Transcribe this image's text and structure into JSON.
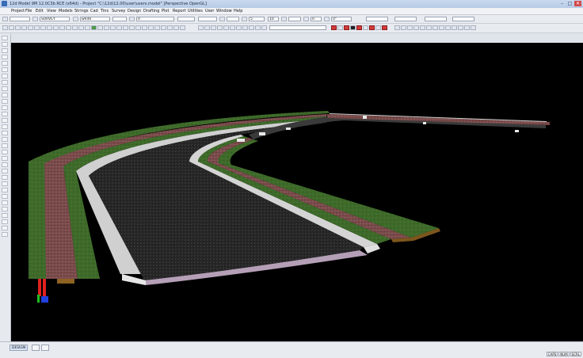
{
  "window": {
    "title": "12d Model 9M 12.0C3b RCE (x64d) - Project \"C:\\12d\\12.00\\user\\users.model\" [Perspective OpenGL]",
    "minimize": "–",
    "maximize": "□",
    "close": "✕"
  },
  "menubar": [
    "Project",
    "File",
    "Edit",
    "View",
    "Models",
    "Strings",
    "Cad",
    "Tins",
    "Survey",
    "Design",
    "Drafting",
    "Plot",
    "Report",
    "Utilities",
    "User",
    "Window",
    "Help"
  ],
  "toolbar1": {
    "model": "SURVEY",
    "colour": "white",
    "linetype_value": "0",
    "weight_value": "5",
    "text_size": "10",
    "angle_value": "0",
    "rotation_value": "0°"
  },
  "statusbar": {
    "tabs": [
      "DESIGN",
      "",
      ""
    ],
    "indicators": [
      "CAPS",
      "NUM",
      "SCRL"
    ]
  },
  "colors": {
    "background": "#000000",
    "asphalt": "#2b2b2b",
    "grass": "#3f6b2a",
    "paving": "#7a4a4a",
    "kerb": "#d8d8d8",
    "axis_x": "#e02020",
    "axis_y": "#20c020",
    "axis_z": "#2040e0"
  }
}
